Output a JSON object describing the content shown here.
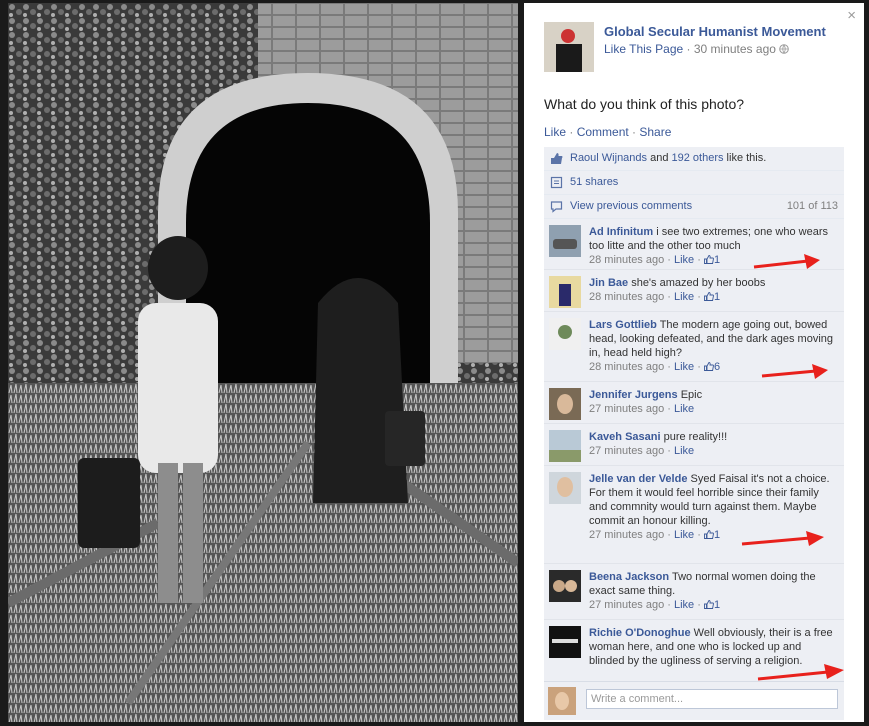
{
  "page": {
    "name": "Global Secular Humanist Movement",
    "like_page": "Like This Page",
    "time": "30 minutes ago",
    "close": "×"
  },
  "post": {
    "text": "What do you think of this photo?",
    "actions": [
      "Like",
      "Comment",
      "Share"
    ]
  },
  "likes": {
    "first": "Raoul Wijnands",
    "and": " and ",
    "others": "192 others",
    "suffix": " like this."
  },
  "shares": {
    "label": "51 shares"
  },
  "prev": {
    "label": "View previous comments",
    "count": "101 of 113"
  },
  "comments": [
    {
      "author": "Ad Infinitum",
      "text": " i see two extremes; one who wears too litte and the other too much",
      "time": "28 minutes ago",
      "like": "Like",
      "likes": "1"
    },
    {
      "author": "Jin Bae",
      "text": " she's amazed by her boobs",
      "time": "28 minutes ago",
      "like": "Like",
      "likes": "1"
    },
    {
      "author": "Lars Gottlieb",
      "text": " The modern age going out, bowed head, looking defeated, and the dark ages moving in, head held high?",
      "time": "28 minutes ago",
      "like": "Like",
      "likes": "6"
    },
    {
      "author": "Jennifer Jurgens",
      "text": " Epic",
      "time": "27 minutes ago",
      "like": "Like",
      "likes": ""
    },
    {
      "author": "Kaveh Sasani",
      "text": " pure reality!!!",
      "time": "27 minutes ago",
      "like": "Like",
      "likes": ""
    },
    {
      "author": "Jelle van der Velde",
      "text": " Syed Faisal it's not a choice. For them it would feel horrible since their family and commnity would turn against them. Maybe commit an honour killing.",
      "time": "27 minutes ago",
      "like": "Like",
      "likes": "1"
    },
    {
      "author": "Beena Jackson",
      "text": " Two normal women doing the exact same thing.",
      "time": "27 minutes ago",
      "like": "Like",
      "likes": "1"
    },
    {
      "author": "Richie O'Donoghue",
      "text": " Well obviously, their is a free woman here, and one who is locked up and blinded by the ugliness of serving a religion.",
      "time": "",
      "like": "",
      "likes": ""
    }
  ],
  "compose": {
    "placeholder": "Write a comment..."
  },
  "icons": [
    "close-icon",
    "globe-icon",
    "like-thumb-icon",
    "share-icon",
    "comment-icon"
  ],
  "colors": {
    "link": "#3b5998",
    "ufi_bg": "#edeff4",
    "arrow": "#e8211c"
  }
}
